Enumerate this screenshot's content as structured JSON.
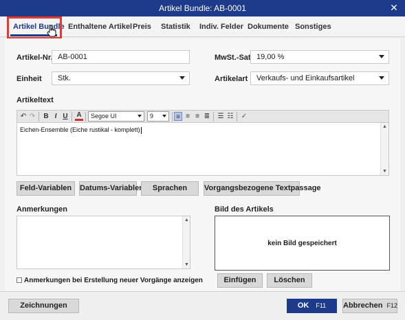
{
  "window": {
    "title": "Artikel Bundle: AB-0001",
    "close_glyph": "✕"
  },
  "tabs": [
    {
      "label": "Artikel Bundle"
    },
    {
      "label": "Enthaltene Artikel"
    },
    {
      "label": "Preis"
    },
    {
      "label": "Statistik"
    },
    {
      "label": "Indiv. Felder"
    },
    {
      "label": "Dokumente"
    },
    {
      "label": "Sonstiges"
    }
  ],
  "form": {
    "artikel_nr_label": "Artikel-Nr.",
    "artikel_nr_value": "AB-0001",
    "einheit_label": "Einheit",
    "einheit_value": "Stk.",
    "mwst_label": "MwSt.-Satz",
    "mwst_value": "19,00 %",
    "artikelart_label": "Artikelart",
    "artikelart_value": "Verkaufs- und Einkaufsartikel",
    "artikeltext_label": "Artikeltext"
  },
  "editor": {
    "font_name": "Segoe UI",
    "font_size": "9",
    "text": "Eichen-Ensemble (Eiche rustikal - komplett)"
  },
  "editor_buttons": {
    "feld_variablen": "Feld-Variablen",
    "datums_variablen": "Datums-Variablen",
    "sprachen": "Sprachen",
    "vorgangsbezogene": "Vorgangsbezogene Textpassage"
  },
  "notes": {
    "label": "Anmerkungen"
  },
  "image": {
    "label": "Bild des Artikels",
    "empty_text": "kein Bild gespeichert"
  },
  "image_buttons": {
    "einfuegen": "Einfügen",
    "loeschen": "Löschen"
  },
  "checkbox": {
    "label": "Anmerkungen bei Erstellung neuer Vorgänge anzeigen",
    "checked": false
  },
  "footer": {
    "zeichnungen": "Zeichnungen",
    "ok": "OK",
    "ok_key": "F11",
    "abbrechen": "Abbrechen",
    "abbrechen_key": "F12"
  },
  "colors": {
    "accent": "#1e3a8a",
    "highlight": "#e53935"
  }
}
